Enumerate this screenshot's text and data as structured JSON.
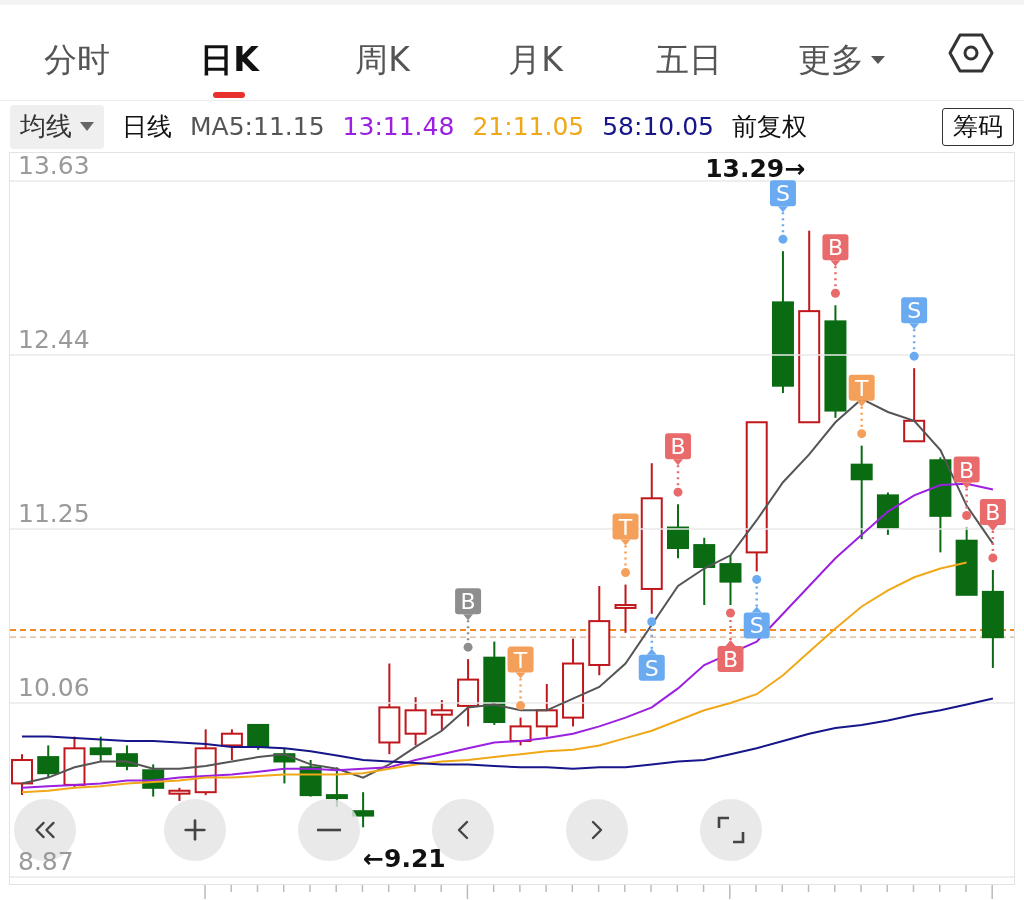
{
  "tabs": [
    {
      "label": "分时",
      "selected": false,
      "kind": "plain"
    },
    {
      "label": "日K",
      "selected": true,
      "kind": "plain"
    },
    {
      "label": "周K",
      "selected": false,
      "kind": "plain"
    },
    {
      "label": "月K",
      "selected": false,
      "kind": "plain"
    },
    {
      "label": "五日",
      "selected": false,
      "kind": "plain"
    },
    {
      "label": "更多",
      "selected": false,
      "kind": "menu"
    }
  ],
  "toolbar": {
    "ma_menu": "均线",
    "period": "日线",
    "adjust": "前复权",
    "chips_button": "筹码"
  },
  "chart": {
    "chart_data": {
      "type": "line",
      "grid": true,
      "ylim": [
        8.87,
        13.63
      ],
      "yticks": [
        13.63,
        12.44,
        11.25,
        10.06,
        8.87
      ],
      "series": [
        {
          "name": "MA5:11.15",
          "color": "#555555",
          "values": [
            9.51,
            9.55,
            9.62,
            9.66,
            9.66,
            9.61,
            9.61,
            9.63,
            9.66,
            9.69,
            9.71,
            9.64,
            9.61,
            9.55,
            9.64,
            9.76,
            9.87,
            10.03,
            10.05,
            10.01,
            10.01,
            10.09,
            10.17,
            10.33,
            null,
            10.86,
            10.98,
            11.07,
            11.31,
            11.57,
            11.76,
            11.98,
            12.14,
            12.05,
            11.99,
            11.79,
            11.41,
            11.15
          ]
        },
        {
          "name": "13:11.48",
          "color": "#9b20e0",
          "values": [
            9.48,
            9.49,
            9.5,
            9.51,
            9.53,
            9.53,
            9.55,
            9.56,
            9.57,
            9.59,
            9.61,
            9.61,
            9.6,
            9.61,
            9.62,
            9.67,
            9.71,
            9.75,
            9.79,
            9.8,
            9.82,
            9.85,
            9.9,
            9.96,
            10.03,
            10.16,
            10.32,
            null,
            10.48,
            10.67,
            10.86,
            11.05,
            11.21,
            11.37,
            11.48,
            11.55,
            11.56,
            11.52
          ]
        },
        {
          "name": "21:11.05",
          "color": "#f0a818",
          "values": [
            9.45,
            9.46,
            9.48,
            9.49,
            9.51,
            9.52,
            9.53,
            9.55,
            9.55,
            9.56,
            9.57,
            9.57,
            9.57,
            9.58,
            9.61,
            9.64,
            9.66,
            9.67,
            9.69,
            9.71,
            9.73,
            9.74,
            9.77,
            9.82,
            9.87,
            9.94,
            10.01,
            10.06,
            10.12,
            10.25,
            10.41,
            10.57,
            10.72,
            10.83,
            10.92,
            10.98,
            11.02,
            null
          ]
        },
        {
          "name": "58:10.05",
          "color": "#16168a",
          "values": [
            9.83,
            9.83,
            9.82,
            9.81,
            9.8,
            9.8,
            9.79,
            9.78,
            9.76,
            9.76,
            9.75,
            9.73,
            9.7,
            9.67,
            9.66,
            9.65,
            9.64,
            9.64,
            9.63,
            9.62,
            9.62,
            9.61,
            9.62,
            9.62,
            9.64,
            9.66,
            9.67,
            9.71,
            9.75,
            9.8,
            9.85,
            9.89,
            9.91,
            9.94,
            9.98,
            10.01,
            10.05,
            10.09
          ]
        }
      ]
    },
    "signals": [
      {
        "label": "B",
        "color": "#8e8e8e",
        "kind": "above"
      },
      {
        "label": "T",
        "color": "#f5a05a",
        "kind": "above"
      },
      {
        "label": "T",
        "color": "#f5a05a",
        "kind": "above"
      },
      {
        "label": "S",
        "color": "#6aaaf0",
        "kind": "below"
      },
      {
        "label": "B",
        "color": "#e86a6a",
        "kind": "above"
      },
      {
        "label": "B",
        "color": "#e86a6a",
        "kind": "below"
      },
      {
        "label": "S",
        "color": "#6aaaf0",
        "kind": "below"
      },
      {
        "label": "S",
        "color": "#6aaaf0",
        "kind": "above"
      },
      {
        "label": "B",
        "color": "#e86a6a",
        "kind": "above"
      },
      {
        "label": "T",
        "color": "#f5a05a",
        "kind": "above"
      },
      {
        "label": "S",
        "color": "#6aaaf0",
        "kind": "above"
      },
      {
        "label": "B",
        "color": "#e86a6a",
        "kind": "above"
      },
      {
        "label": "B",
        "color": "#e86a6a",
        "kind": "above"
      }
    ],
    "high_label": "13.29→",
    "low_label": "←9.21"
  }
}
